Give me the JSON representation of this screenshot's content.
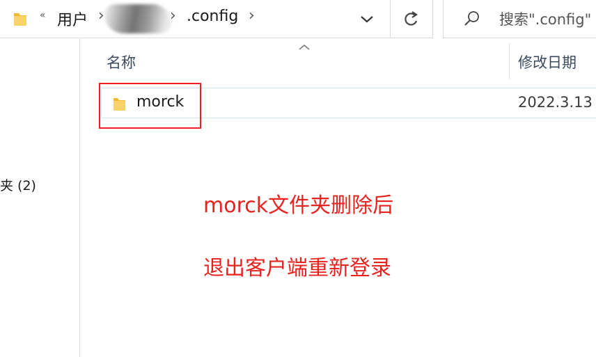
{
  "address_bar": {
    "overflow": "«",
    "breadcrumbs": [
      "用户",
      ".config"
    ],
    "separator": "›"
  },
  "search": {
    "placeholder": "搜索\".config\""
  },
  "columns": {
    "name": "名称",
    "date_modified": "修改日期"
  },
  "files": [
    {
      "name": "morck",
      "date_modified": "2022.3.13",
      "icon": "folder-icon"
    }
  ],
  "sidebar": {
    "item_label": "夹 (2)"
  },
  "annotations": [
    "morck文件夹删除后",
    "退出客户端重新登录"
  ],
  "colors": {
    "annotation": "#e8231f",
    "folder": "#f7c948",
    "selection_border": "#cde6f7"
  }
}
